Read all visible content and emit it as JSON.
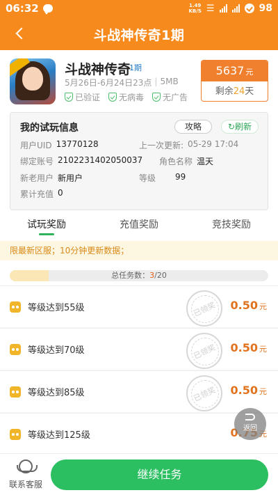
{
  "status_bar": {
    "time": "06:32",
    "speed_value": "1.49",
    "speed_unit": "KB/S",
    "battery": "98"
  },
  "header": {
    "title": "斗战神传奇1期"
  },
  "game": {
    "name": "斗战神传奇",
    "issue": "1期",
    "date_range": "5月26日-6月24日23点",
    "size": "5MB",
    "badges": [
      "已验证",
      "无病毒",
      "无广告"
    ],
    "price": "5637",
    "price_unit": "元",
    "remaining_prefix": "剩余",
    "remaining_days": "24",
    "remaining_suffix": "天"
  },
  "trial_info": {
    "title": "我的试玩信息",
    "guide_button": "攻略",
    "refresh_button": "刷新",
    "uid_label": "用户UID",
    "uid_value": "13770128",
    "last_update_label": "上一次更新:",
    "last_update_value": "05-29 17:04",
    "bind_label": "绑定账号",
    "bind_value": "2102231402050037",
    "role_label": "角色名称",
    "role_value": "温天",
    "newold_label": "新老用户",
    "newold_value": "新用户",
    "level_label": "等级",
    "level_value": "99",
    "recharge_label": "累计充值",
    "recharge_value": "0"
  },
  "tabs": [
    "试玩奖励",
    "充值奖励",
    "竞技奖励"
  ],
  "notice": "限最新区服；10分钟更新数据；",
  "progress": {
    "label": "总任务数：",
    "done": "3",
    "total": "/20",
    "fraction": 0.15
  },
  "tasks": [
    {
      "label": "等级达到55级",
      "reward": "0.50",
      "unit": "元",
      "stamp": "已领奖"
    },
    {
      "label": "等级达到70级",
      "reward": "0.50",
      "unit": "元",
      "stamp": "已领奖"
    },
    {
      "label": "等级达到85级",
      "reward": "0.50",
      "unit": "元",
      "stamp": "已领奖"
    },
    {
      "label": "等级达到125级",
      "reward": "0.75",
      "unit": "元",
      "stamp": ""
    }
  ],
  "floating_back": "返回",
  "bottom": {
    "customer_service": "联系客服",
    "continue_button": "继续任务"
  },
  "colors": {
    "brand": "#f78a1d",
    "price_accent": "#f07f2e",
    "green": "#2bbf61"
  }
}
